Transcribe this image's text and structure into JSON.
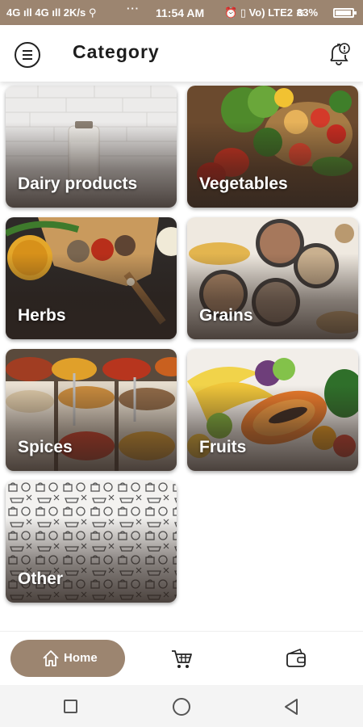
{
  "status_bar": {
    "network": "4G ıll  4G ıll  2K/s  ⚲",
    "more": "···",
    "time": "11:54 AM",
    "icons": "⏰ ▯ Vo) LTE2 ≋",
    "battery": "83%"
  },
  "header": {
    "title": "Category",
    "menu_icon": "hamburger-menu-icon",
    "notification_icon": "bell-alert-icon"
  },
  "categories": [
    {
      "label": "Dairy products",
      "image": "dairy-products-image"
    },
    {
      "label": "Vegetables",
      "image": "vegetables-image"
    },
    {
      "label": "Herbs",
      "image": "herbs-image"
    },
    {
      "label": "Grains",
      "image": "grains-image"
    },
    {
      "label": "Spices",
      "image": "spices-image"
    },
    {
      "label": "Fruits",
      "image": "fruits-image"
    },
    {
      "label": "Other",
      "image": "shopping-pattern-image"
    }
  ],
  "bottom_nav": {
    "home_label": "Home",
    "home_icon": "home-icon",
    "cart_icon": "shopping-cart-icon",
    "wallet_icon": "wallet-icon"
  },
  "system_nav": {
    "recents_icon": "square-icon",
    "home_icon": "circle-icon",
    "back_icon": "triangle-back-icon"
  },
  "colors": {
    "accent": "#9c8570",
    "card_text": "#ffffff",
    "title_text": "#1d1d1d"
  }
}
